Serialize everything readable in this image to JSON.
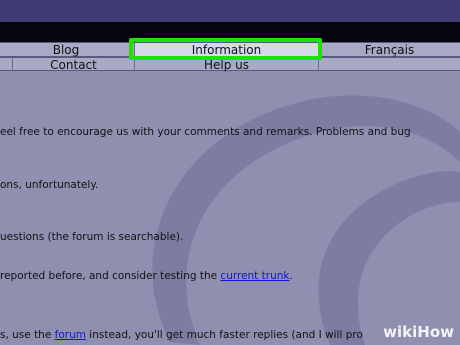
{
  "nav": {
    "row1": [
      "Blog",
      "Information",
      "Français"
    ],
    "row2": [
      "Contact",
      "Help us"
    ]
  },
  "paragraphs": [
    {
      "text": "eel free to encourage us with your comments and remarks. Problems and bug"
    },
    {
      "text": "ons, unfortunately."
    },
    {
      "text": "uestions (the forum is searchable)."
    },
    {
      "before": "reported before, and consider testing the ",
      "link": "current trunk",
      "after": "."
    },
    {
      "before": "s, use the ",
      "link": "forum",
      "after": " instead, you'll get much faster replies (and I will pro"
    }
  ],
  "watermark": "wikiHow"
}
